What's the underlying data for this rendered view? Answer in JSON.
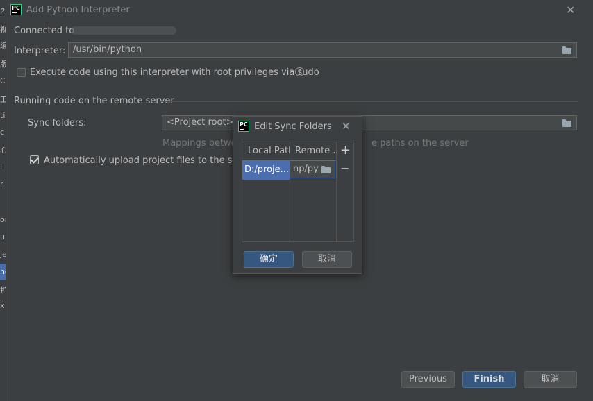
{
  "dialog": {
    "title": "Add Python Interpreter",
    "logo_text": "PC",
    "connected_label": "Connected to",
    "interpreter_label": "Interpreter:",
    "interpreter_value": "/usr/bin/python",
    "sudo_label": "Execute code using this interpreter with root privileges via sudo",
    "sudo_checked": false,
    "section_title": "Running code on the remote server",
    "sync_folders_label": "Sync folders:",
    "sync_folders_value": "<Project root>→",
    "mappings_hint_start": "Mappings betwe",
    "mappings_hint_end": "e paths on the server",
    "auto_upload_label": "Automatically upload project files to the server",
    "auto_upload_checked": true,
    "buttons": {
      "previous": "Previous",
      "finish": "Finish",
      "cancel": "取消"
    }
  },
  "left_strip": {
    "chars": [
      "ƿ",
      "视",
      "编",
      "版",
      "C",
      "工",
      "ti",
      "c",
      "心",
      "l",
      "r",
      "or",
      "ur",
      "je",
      "nc",
      "扩",
      "x"
    ]
  },
  "sync_dialog": {
    "title": "Edit Sync Folders",
    "logo_text": "PC",
    "columns": [
      "Local Path",
      "Remote ..."
    ],
    "rows": [
      {
        "local": "D:/proje...",
        "remote": "np/py"
      }
    ],
    "add_symbol": "+",
    "remove_symbol": "−",
    "ok_label": "确定",
    "cancel_label": "取消"
  },
  "colors": {
    "background": "#3c3f41",
    "field": "#45494a",
    "selection": "#4b6eaf",
    "primary_button": "#365880",
    "logo_accent": "#21d789"
  }
}
